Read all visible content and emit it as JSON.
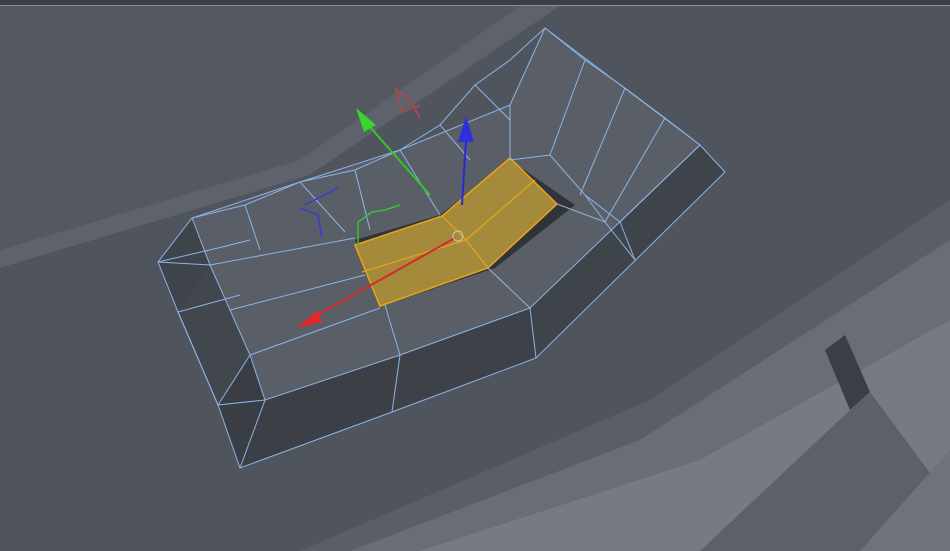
{
  "viewport": {
    "view": "perspective-3d",
    "background_color": "#4a4f57",
    "wireframe_color": "#8ab4e8",
    "selection_color": "#d9a32a",
    "selected_element": "polygon-selection"
  },
  "gizmo": {
    "axes": [
      {
        "name": "x-axis",
        "color": "#d42a2a"
      },
      {
        "name": "y-axis",
        "color": "#35c42a"
      },
      {
        "name": "z-axis",
        "color": "#2a2ad4"
      }
    ]
  }
}
